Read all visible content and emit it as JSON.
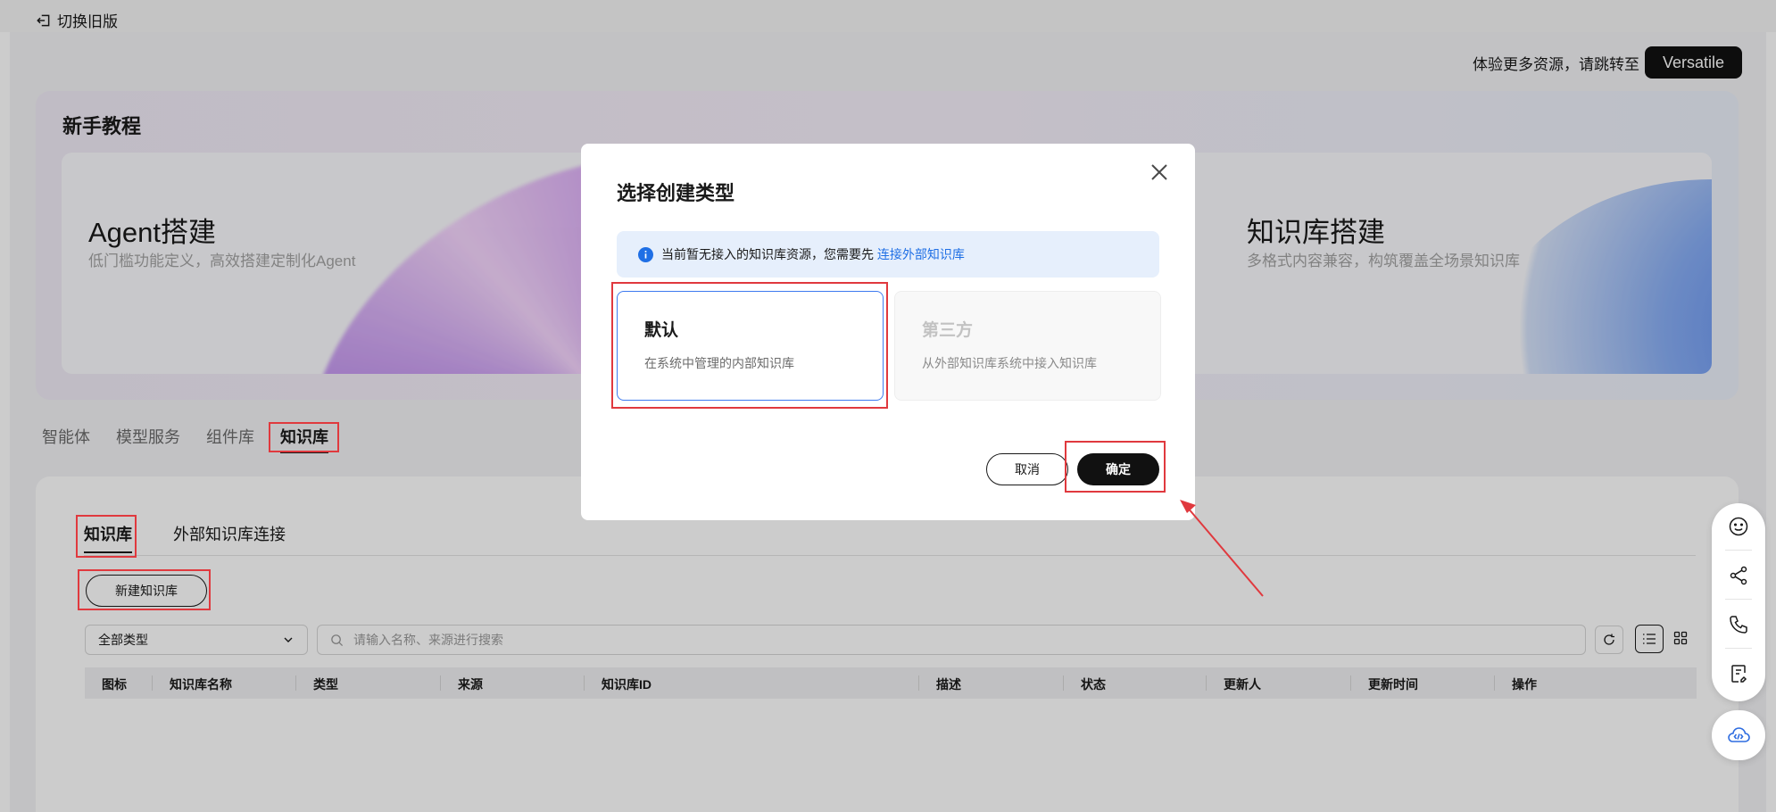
{
  "topbar": {
    "switch_old_label": "切换旧版"
  },
  "promo": {
    "text": "体验更多资源，请跳转至",
    "button_label": "Versatile"
  },
  "tutorial": {
    "title": "新手教程",
    "cards": [
      {
        "title": "Agent搭建",
        "subtitle": "低门槛功能定义，高效搭建定制化Agent"
      },
      {
        "title": "知识库搭建",
        "subtitle": "多格式内容兼容，构筑覆盖全场景知识库"
      }
    ]
  },
  "main_tabs": [
    {
      "label": "智能体"
    },
    {
      "label": "模型服务"
    },
    {
      "label": "组件库"
    },
    {
      "label": "知识库",
      "active": true
    }
  ],
  "sub_tabs": [
    {
      "label": "知识库",
      "active": true
    },
    {
      "label": "外部知识库连接"
    }
  ],
  "new_kb_button": "新建知识库",
  "filter": {
    "type_select_value": "全部类型",
    "search_placeholder": "请输入名称、来源进行搜索"
  },
  "table": {
    "columns": [
      "图标",
      "知识库名称",
      "类型",
      "来源",
      "知识库ID",
      "描述",
      "状态",
      "更新人",
      "更新时间",
      "操作"
    ]
  },
  "dialog": {
    "title": "选择创建类型",
    "notice_text": "当前暂无接入的知识库资源，您需要先",
    "notice_link": "连接外部知识库",
    "options": [
      {
        "title": "默认",
        "desc": "在系统中管理的内部知识库",
        "selected": true
      },
      {
        "title": "第三方",
        "desc": "从外部知识库系统中接入知识库",
        "disabled": true
      }
    ],
    "cancel_label": "取消",
    "confirm_label": "确定"
  },
  "float_toolbar": {
    "icons": [
      "smile-icon",
      "share-icon",
      "phone-icon",
      "feedback-icon",
      "cloud-code-icon"
    ]
  },
  "colors": {
    "highlight": "#e0393e",
    "link": "#1f6fe5",
    "primary": "#111111",
    "selected_border": "#3d7af0"
  }
}
